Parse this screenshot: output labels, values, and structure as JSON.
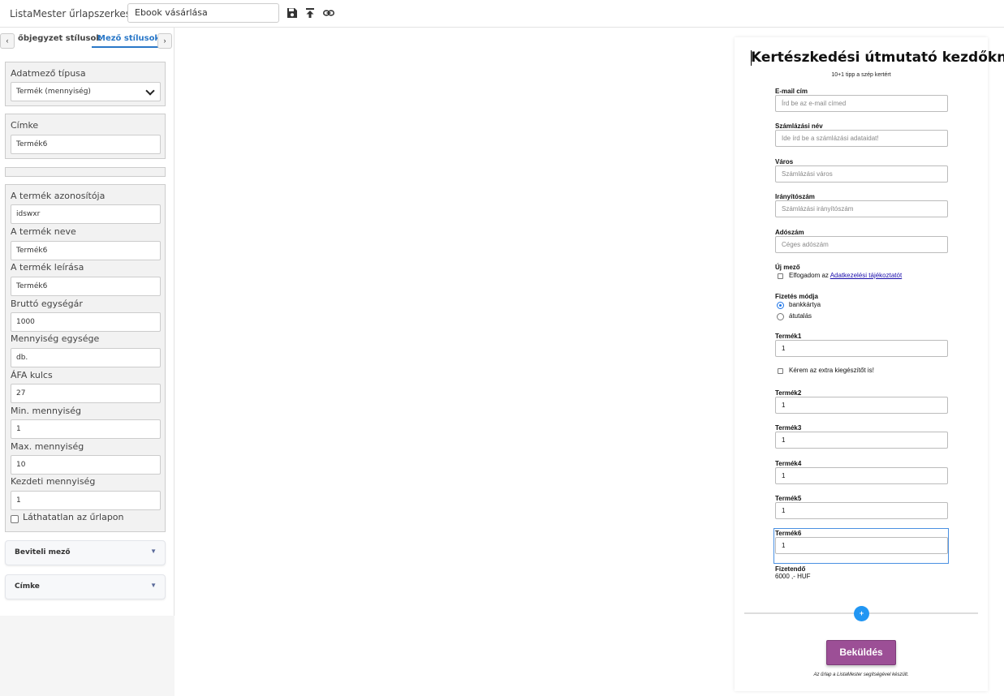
{
  "topbar": {
    "app_title": "ListaMester űrlapszerkesztő:",
    "form_name": "Ebook vásárlása",
    "icons": [
      "save-icon",
      "publish-icon",
      "link-icon"
    ]
  },
  "sidebar": {
    "tabs": {
      "prev_arrow": "‹",
      "inactive": "őbjegyzet stílusok",
      "active": "Mező stílusok",
      "next_arrow": "›"
    },
    "field_type": {
      "label": "Adatmező típusa",
      "value": "Termék (mennyiség)"
    },
    "label_panel": {
      "label": "Címke",
      "value": "Termék6"
    },
    "product": {
      "fields": [
        {
          "label": "A termék azonosítója",
          "value": "idswxr"
        },
        {
          "label": "A termék neve",
          "value": "Termék6"
        },
        {
          "label": "A termék leírása",
          "value": "Termék6"
        },
        {
          "label": "Bruttó egységár",
          "value": "1000"
        },
        {
          "label": "Mennyiség egysége",
          "value": "db."
        },
        {
          "label": "ÁFA kulcs",
          "value": "27"
        },
        {
          "label": "Min. mennyiség",
          "value": "1"
        },
        {
          "label": "Max. mennyiség",
          "value": "10"
        },
        {
          "label": "Kezdeti mennyiség",
          "value": "1"
        }
      ],
      "hidden_label": "Láthatatlan az űrlapon",
      "hidden_checked": false
    },
    "accordions": [
      {
        "label": "Beviteli mező",
        "caret": "▼"
      },
      {
        "label": "Címke",
        "caret": "▼"
      }
    ]
  },
  "form": {
    "title": "Kertészkedési útmutató kezdőknek",
    "subtitle": "10+1 tipp a szép kertért",
    "email": {
      "label": "E-mail cím",
      "placeholder": "Írd be az e-mail címed"
    },
    "billing_name": {
      "label": "Számlázási név",
      "placeholder": "Ide írd be a számlázási adataidat!"
    },
    "city": {
      "label": "Város",
      "placeholder": "Számlázási város"
    },
    "zip": {
      "label": "Irányítószám",
      "placeholder": "Számlázási irányítószám"
    },
    "tax": {
      "label": "Adószám",
      "placeholder": "Céges adószám"
    },
    "new_field": {
      "label": "Új mező",
      "text_before": "Elfogadom az ",
      "link": "Adatkezelési tájékoztatót"
    },
    "payment": {
      "label": "Fizetés módja",
      "options": [
        "bankkártya",
        "átutalás"
      ],
      "selected": "bankkártya"
    },
    "product1": {
      "label": "Termék1",
      "value": "1"
    },
    "extra": {
      "text": "Kérem az extra kiegészítőt is!"
    },
    "product2": {
      "label": "Termék2",
      "value": "1"
    },
    "product3": {
      "label": "Termék3",
      "value": "1"
    },
    "product4": {
      "label": "Termék4",
      "value": "1"
    },
    "product5": {
      "label": "Termék5",
      "value": "1"
    },
    "product6": {
      "label": "Termék6",
      "value": "1"
    },
    "total": {
      "label": "Fizetendő",
      "value": "6000 ,- HUF"
    },
    "add_button": "+",
    "submit": "Beküldés",
    "footer": "Az űrlap a ListaMester segítségével készült."
  },
  "colors": {
    "accent": "#2a78c8",
    "submit": "#9c4f96",
    "add_button": "#2196f3",
    "selection": "#4a90e2"
  }
}
